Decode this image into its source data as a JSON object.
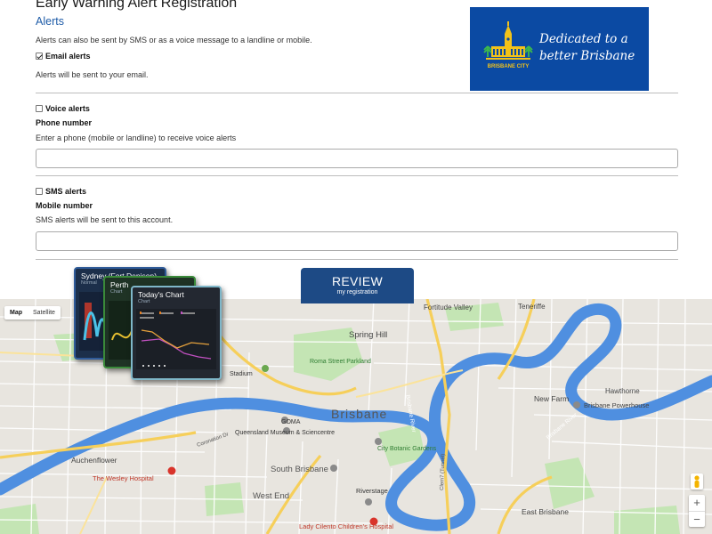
{
  "page": {
    "title": "Early Warning Alert Registration",
    "subtitle": "Alerts",
    "intro": "Alerts can also be sent by SMS or as a voice message to a landline or mobile."
  },
  "email": {
    "label": "Email alerts",
    "checked": true,
    "note": "Alerts will be sent to your email."
  },
  "voice": {
    "label": "Voice alerts",
    "checked": false,
    "field_label": "Phone number",
    "help": "Enter a phone (mobile or landline) to receive voice alerts",
    "value": ""
  },
  "sms": {
    "label": "SMS alerts",
    "checked": false,
    "field_label": "Mobile number",
    "help": "SMS alerts will be sent to this account.",
    "value": ""
  },
  "banner": {
    "brand": "BRISBANE CITY",
    "slogan": "Dedicated to a better Brisbane",
    "bg": "#0b4aa3"
  },
  "review_button": {
    "label": "REVIEW",
    "sublabel": "my registration",
    "bg": "#1d4a85"
  },
  "charts_cards": [
    {
      "title": "Sydney (Fort Denison)",
      "subtitle": "Normal"
    },
    {
      "title": "Perth",
      "subtitle": "Chart"
    },
    {
      "title": "Today's Chart",
      "subtitle": "Chart"
    }
  ],
  "map": {
    "type_buttons": [
      "Map",
      "Satellite"
    ],
    "active_type": "Map",
    "labels": {
      "fortitude_valley": "Fortitude Valley",
      "teneriffe": "Teneriffe",
      "spring_hill": "Spring Hill",
      "roma_street": "Roma Street Parkland",
      "new_farm": "New Farm",
      "hawthorne": "Hawthorne",
      "powerhouse": "Brisbane Powerhouse",
      "brisbane": "Brisbane",
      "goma": "GOMA",
      "museum": "Queensland Museum & Sciencentre",
      "botanic": "City Botanic Gardens",
      "auchenflower": "Auchenflower",
      "wesley": "The Wesley Hospital",
      "south_brisbane": "South Brisbane",
      "riverstage": "Riverstage",
      "west_end": "West End",
      "lady_cilento": "Lady Cilento Children's Hospital",
      "east_brisbane": "East Brisbane",
      "stadium": "Stadium",
      "river1": "Brisbane River",
      "river2": "Brisbane River",
      "coronation": "Coronation Dr",
      "clem7": "Clem7 (Tunnel)"
    },
    "colors": {
      "land": "#e8e5df",
      "water": "#4f8fe0",
      "park": "#c4e5b4",
      "highway": "#f6cf5a"
    }
  }
}
